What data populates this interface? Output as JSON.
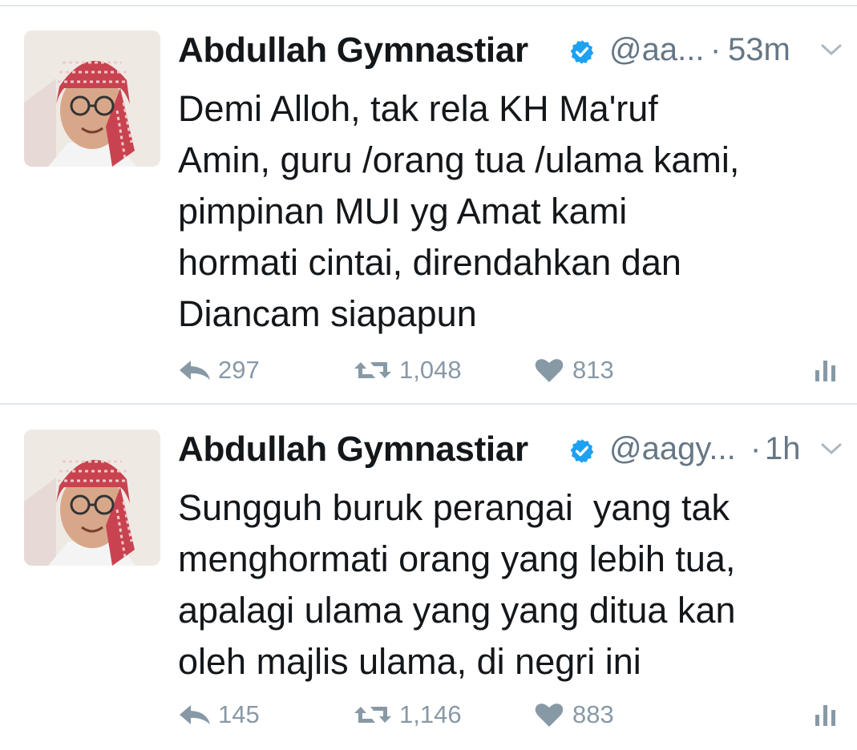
{
  "tweets": [
    {
      "name": "Abdullah Gymnastiar",
      "handle": "@aa...",
      "dot": "·",
      "time": "53m",
      "lines": [
        "Demi Alloh, tak rela KH Ma'ruf",
        "Amin, guru /orang tua /ulama kami,",
        "pimpinan MUI yg Amat kami",
        "hormati cintai, direndahkan dan",
        "Diancam siapapun"
      ],
      "replies": "297",
      "retweets": "1,048",
      "likes": "813"
    },
    {
      "name": "Abdullah Gymnastiar",
      "handle": "@aagy...",
      "dot": "·",
      "time": "1h",
      "lines": [
        "Sungguh buruk perangai  yang tak",
        "menghormati orang yang lebih tua,",
        "apalagi ulama yang yang ditua kan",
        "oleh majlis ulama, di negri ini"
      ],
      "replies": "145",
      "retweets": "1,146",
      "likes": "883"
    }
  ],
  "icons": {
    "verified": "verified-badge-icon",
    "caret": "chevron-down-icon",
    "reply": "reply-icon",
    "retweet": "retweet-icon",
    "like": "heart-icon",
    "analytics": "analytics-icon"
  },
  "colors": {
    "verified": "#1da1f2",
    "muted": "#8899a6",
    "text": "#14171a",
    "turban_red": "#c8434f"
  }
}
